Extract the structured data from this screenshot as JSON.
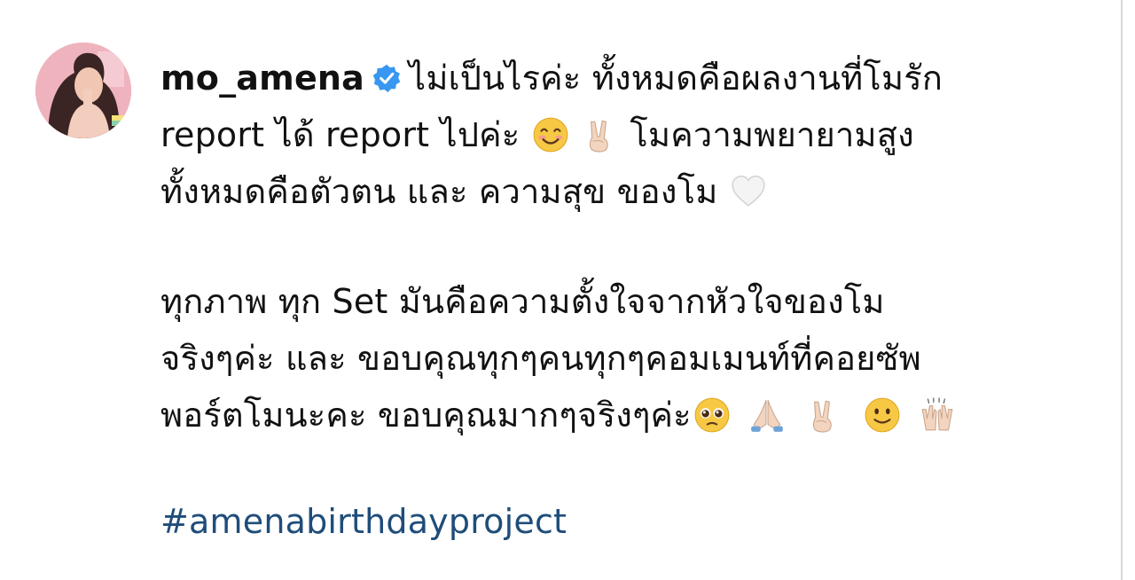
{
  "post": {
    "username": "mo_amena",
    "verified_icon": "verified-badge-icon",
    "caption": {
      "line1": "ไม่เป็นไรค่ะ ทั้งหมดคือผลงานที่โมรัก",
      "line2_a": "report ได้ report ไปค่ะ",
      "line2_b": "โมความพยายามสูง",
      "line3": "ทั้งหมดคือตัวตน และ ความสุข ของโม",
      "line4": "ทุกภาพ ทุก Set มันคือความตั้งใจจากหัวใจของโม",
      "line5": "จริงๆค่ะ และ ขอบคุณทุกๆคนทุกๆคอมเมนท์ที่คอยซัพ",
      "line6": "พอร์ตโมนะคะ ขอบคุณมากๆจริงๆค่ะ"
    },
    "hashtag": "#amenabirthdayproject",
    "emojis": [
      "smiling-face-icon",
      "victory-hand-icon",
      "white-heart-icon",
      "pleading-face-icon",
      "folded-hands-icon",
      "victory-hand-icon",
      "slightly-smiling-face-icon",
      "raising-hands-icon"
    ],
    "colors": {
      "verified": "#3897f0",
      "hashtag": "#1f4d7a",
      "text": "#111111"
    }
  }
}
